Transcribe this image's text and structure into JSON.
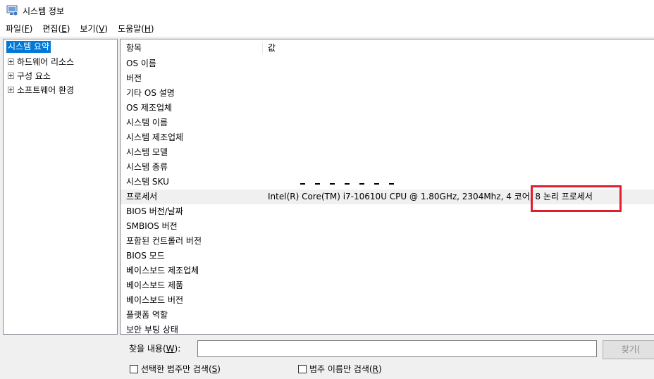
{
  "window": {
    "title": "시스템 정보"
  },
  "menu": [
    {
      "label": "파일(",
      "accel": "F",
      "tail": ")"
    },
    {
      "label": "편집(",
      "accel": "E",
      "tail": ")"
    },
    {
      "label": "보기(",
      "accel": "V",
      "tail": ")"
    },
    {
      "label": "도움말(",
      "accel": "H",
      "tail": ")"
    }
  ],
  "tree": {
    "selected": "시스템 요약",
    "items": [
      "하드웨어 리소스",
      "구성 요소",
      "소프트웨어 환경"
    ]
  },
  "table": {
    "headers": {
      "item": "항목",
      "value": "값"
    },
    "rows": [
      {
        "item": "OS 이름",
        "value": ""
      },
      {
        "item": "버전",
        "value": ""
      },
      {
        "item": "기타 OS 설명",
        "value": ""
      },
      {
        "item": "OS 제조업체",
        "value": ""
      },
      {
        "item": "시스템 이름",
        "value": ""
      },
      {
        "item": "시스템 제조업체",
        "value": ""
      },
      {
        "item": "시스템 모델",
        "value": ""
      },
      {
        "item": "시스템 종류",
        "value": ""
      },
      {
        "item": "시스템 SKU",
        "value": ""
      },
      {
        "item": "프로세서",
        "value": "Intel(R) Core(TM) i7-10610U CPU @ 1.80GHz, 2304Mhz, 4 코어, 8 논리 프로세서"
      },
      {
        "item": "BIOS 버전/날짜",
        "value": ""
      },
      {
        "item": "SMBIOS 버전",
        "value": ""
      },
      {
        "item": "포함된 컨트롤러 버전",
        "value": ""
      },
      {
        "item": "BIOS 모드",
        "value": ""
      },
      {
        "item": "베이스보드 제조업체",
        "value": ""
      },
      {
        "item": "베이스보드 제품",
        "value": ""
      },
      {
        "item": "베이스보드 버전",
        "value": ""
      },
      {
        "item": "플랫폼 역할",
        "value": ""
      },
      {
        "item": "보안 부팅 상태",
        "value": ""
      }
    ],
    "highlighted_row": 9
  },
  "find": {
    "label": "찾을 내용(",
    "label_accel": "W",
    "label_tail": "):",
    "input_value": "",
    "button_label": "찾기(",
    "check1": {
      "label": "선택한 범주만 검색(",
      "accel": "S",
      "tail": ")"
    },
    "check2": {
      "label": "범주 이름만 검색(",
      "accel": "R",
      "tail": ")"
    }
  },
  "colors": {
    "selection": "#0078d7",
    "annotation_box": "#e01e2d"
  }
}
